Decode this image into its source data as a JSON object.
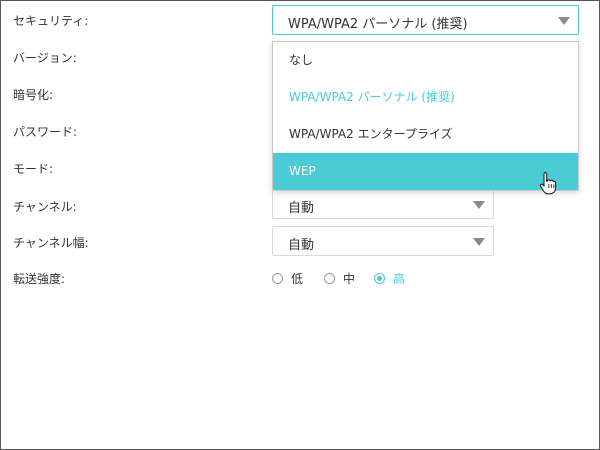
{
  "form": {
    "security": {
      "label": "セキュリティ:",
      "value": "WPA/WPA2 パーソナル (推奨)"
    },
    "version": {
      "label": "バージョン:"
    },
    "encryption": {
      "label": "暗号化:"
    },
    "password": {
      "label": "パスワード:"
    },
    "mode": {
      "label": "モード:"
    },
    "channel": {
      "label": "チャンネル:",
      "value": "自動"
    },
    "channel_width": {
      "label": "チャンネル幅:",
      "value": "自動"
    },
    "tx_power": {
      "label": "転送強度:",
      "options": [
        "低",
        "中",
        "高"
      ],
      "selected": "高"
    }
  },
  "dropdown": {
    "options": [
      "なし",
      "WPA/WPA2 パーソナル (推奨)",
      "WPA/WPA2 エンタープライズ",
      "WEP"
    ],
    "selected": "WPA/WPA2 パーソナル (推奨)",
    "hovered": "WEP"
  },
  "colors": {
    "accent": "#4acbd6",
    "text": "#333333",
    "border": "#d9d9d9"
  },
  "icons": {
    "cursor": "hand-pointer-icon",
    "select_arrow": "chevron-down-icon"
  }
}
